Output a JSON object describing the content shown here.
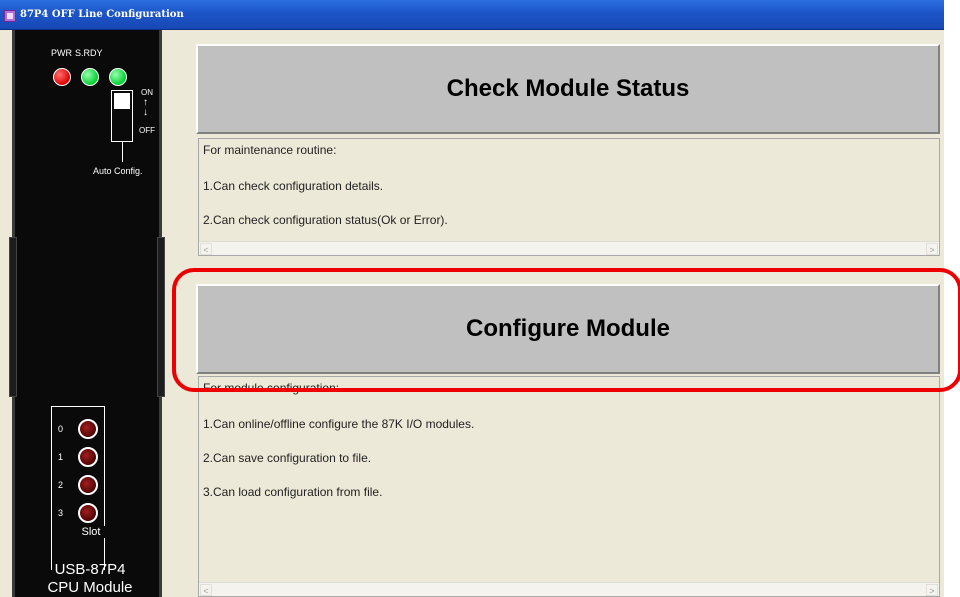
{
  "window": {
    "title": "87P4 OFF Line Configuration"
  },
  "cpu_panel": {
    "led_labels": [
      "PWR",
      "S.RDY"
    ],
    "switch_on": "ON",
    "switch_off": "OFF",
    "switch_arrow": "↑\n↓",
    "auto_config": "Auto Config.",
    "slot_numbers": [
      "0",
      "1",
      "2",
      "3"
    ],
    "slot_label": "Slot",
    "model_line1": "USB-87P4",
    "model_line2": "CPU Module"
  },
  "check_status": {
    "button_label": "Check Module Status",
    "lines": [
      "For maintenance routine:",
      "1.Can check configuration details.",
      "2.Can check configuration status(Ok or Error)."
    ]
  },
  "configure": {
    "button_label": "Configure Module",
    "lines": [
      "For module configuration:",
      "1.Can online/offline configure the 87K I/O modules.",
      "2.Can save configuration to file.",
      "3.Can load configuration from file."
    ]
  },
  "scrollbar": {
    "left_arrow": "<",
    "right_arrow": ">"
  },
  "colors": {
    "titlebar": "#1c55c8",
    "highlight": "#ee0000",
    "led_power": "#e00000",
    "led_ready": "#00d030"
  },
  "icons": {
    "app": "app-icon",
    "scroll_left": "scroll-left-icon",
    "scroll_right": "scroll-right-icon"
  }
}
